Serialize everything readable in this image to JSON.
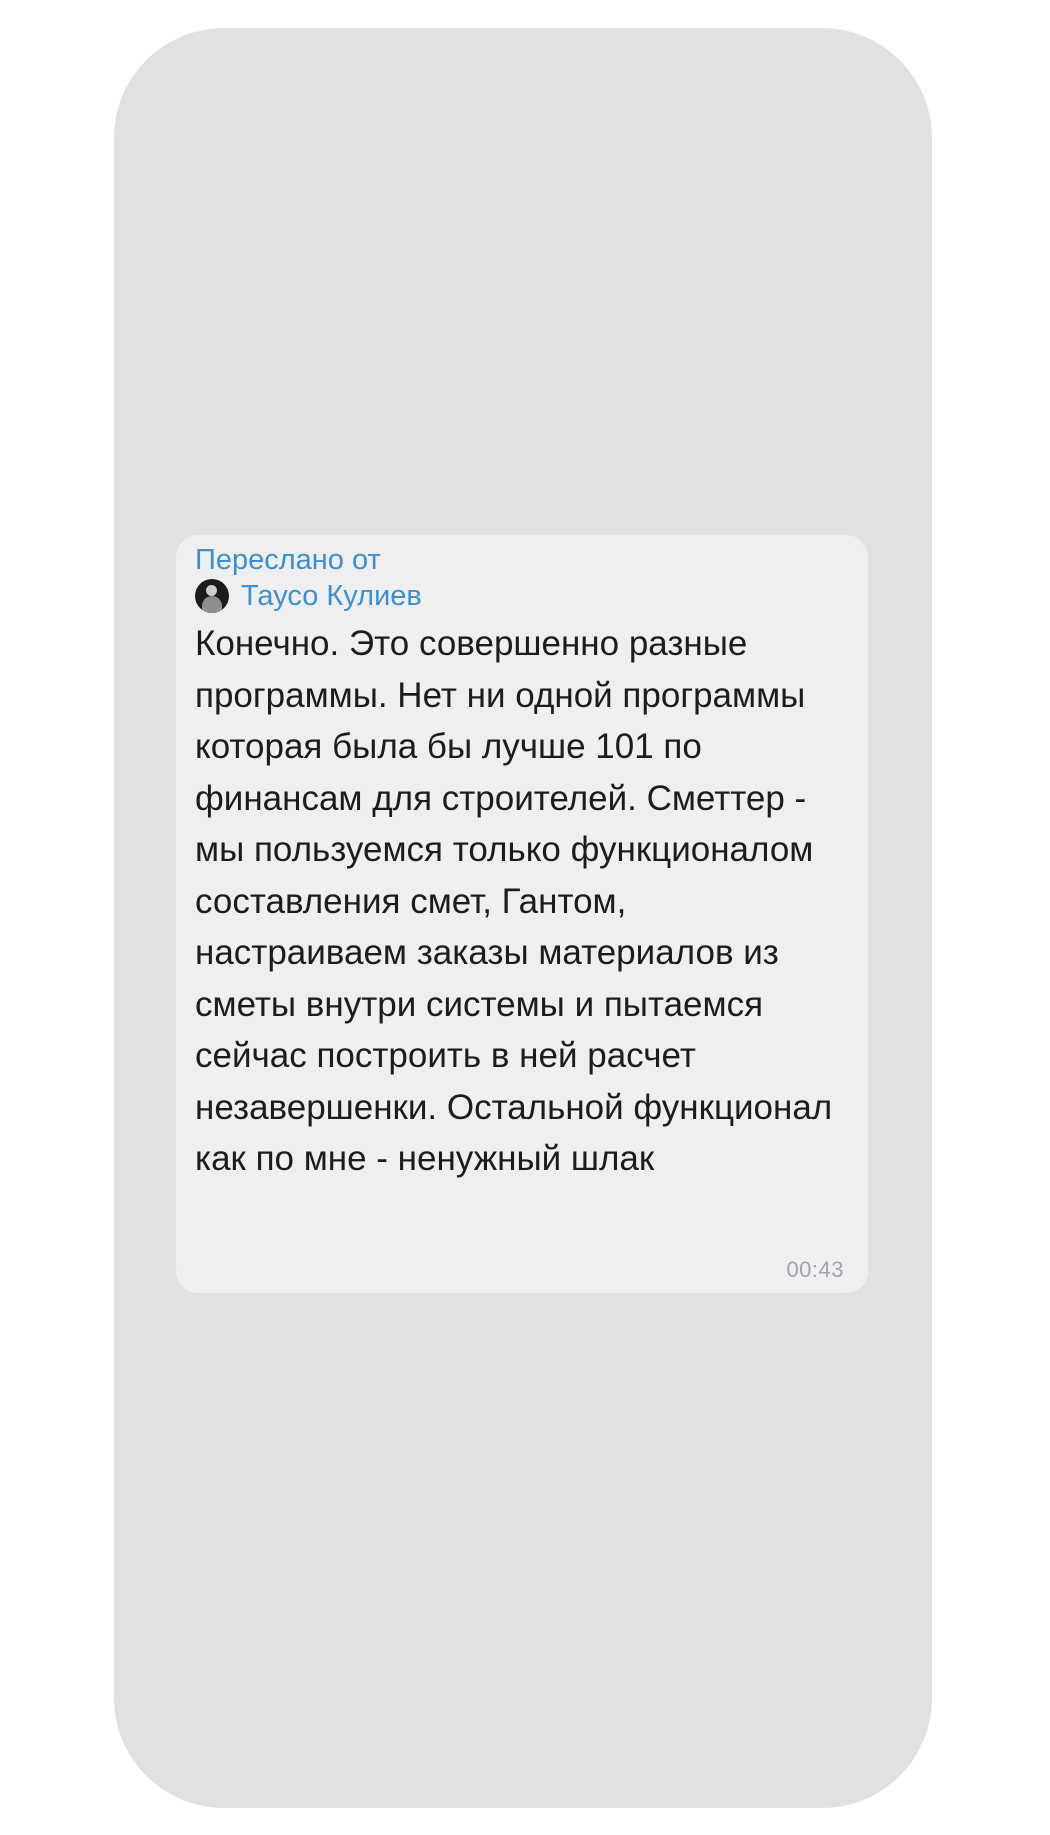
{
  "message": {
    "forwarded_label": "Переслано от",
    "sender_name": "Таусо Кулиев",
    "text": "Конечно. Это совершенно разные программы. Нет ни одной программы которая была бы лучше 101 по финансам для строителей. Сметтер - мы пользуемся только функционалом составления смет, Гантом, настраиваем заказы материалов из сметы внутри системы и пытаемся сейчас построить в ней расчет незавершенки. Остальной функционал как по мне - ненужный шлак",
    "time": "00:43"
  },
  "colors": {
    "background": "#ffffff",
    "panel": "#e1e1e1",
    "bubble": "#efeff1",
    "link_blue": "#3f8fd0",
    "text": "#1c1c1e",
    "timestamp": "#a3a3a8"
  },
  "icons": {
    "avatar": "sender-avatar-photo"
  }
}
